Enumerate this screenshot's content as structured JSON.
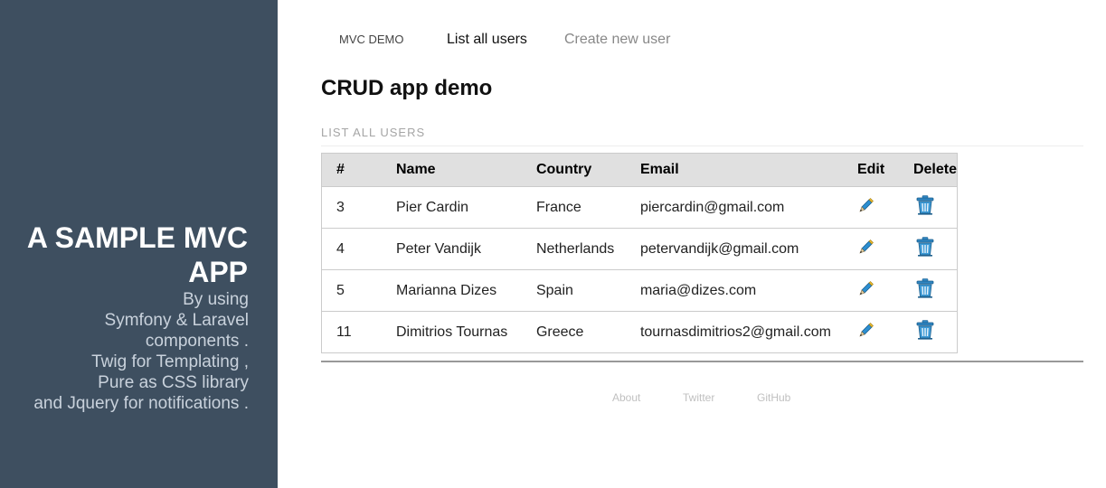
{
  "sidebar": {
    "brand_line1": "A SAMPLE MVC",
    "brand_line2": "APP",
    "tagline": [
      "By using",
      "Symfony & Laravel",
      "components .",
      "Twig for Templating ,",
      "Pure as CSS library",
      "and Jquery for notifications ."
    ],
    "background_color": "#3e4f60"
  },
  "nav": {
    "heading": "MVC DEMO",
    "list_users": "List all users",
    "create_user": "Create new user"
  },
  "page": {
    "title": "CRUD app demo",
    "section_label": "LIST ALL USERS"
  },
  "table": {
    "headers": [
      "#",
      "Name",
      "Country",
      "Email",
      "Edit",
      "Delete"
    ],
    "rows": [
      {
        "id": "3",
        "name": "Pier Cardin",
        "country": "France",
        "email": "piercardin@gmail.com",
        "edit_icon": "pencil-icon",
        "delete_icon": "trash-icon"
      },
      {
        "id": "4",
        "name": "Peter Vandijk",
        "country": "Netherlands",
        "email": "petervandijk@gmail.com",
        "edit_icon": "pencil-icon",
        "delete_icon": "trash-icon"
      },
      {
        "id": "5",
        "name": "Marianna Dizes",
        "country": "Spain",
        "email": "maria@dizes.com",
        "edit_icon": "pencil-icon",
        "delete_icon": "trash-icon"
      },
      {
        "id": "11",
        "name": "Dimitrios Tournas",
        "country": "Greece",
        "email": "tournasdimitrios2@gmail.com",
        "edit_icon": "pencil-icon",
        "delete_icon": "trash-icon"
      }
    ]
  },
  "footer": {
    "about": "About",
    "twitter": "Twitter",
    "github": "GitHub"
  }
}
